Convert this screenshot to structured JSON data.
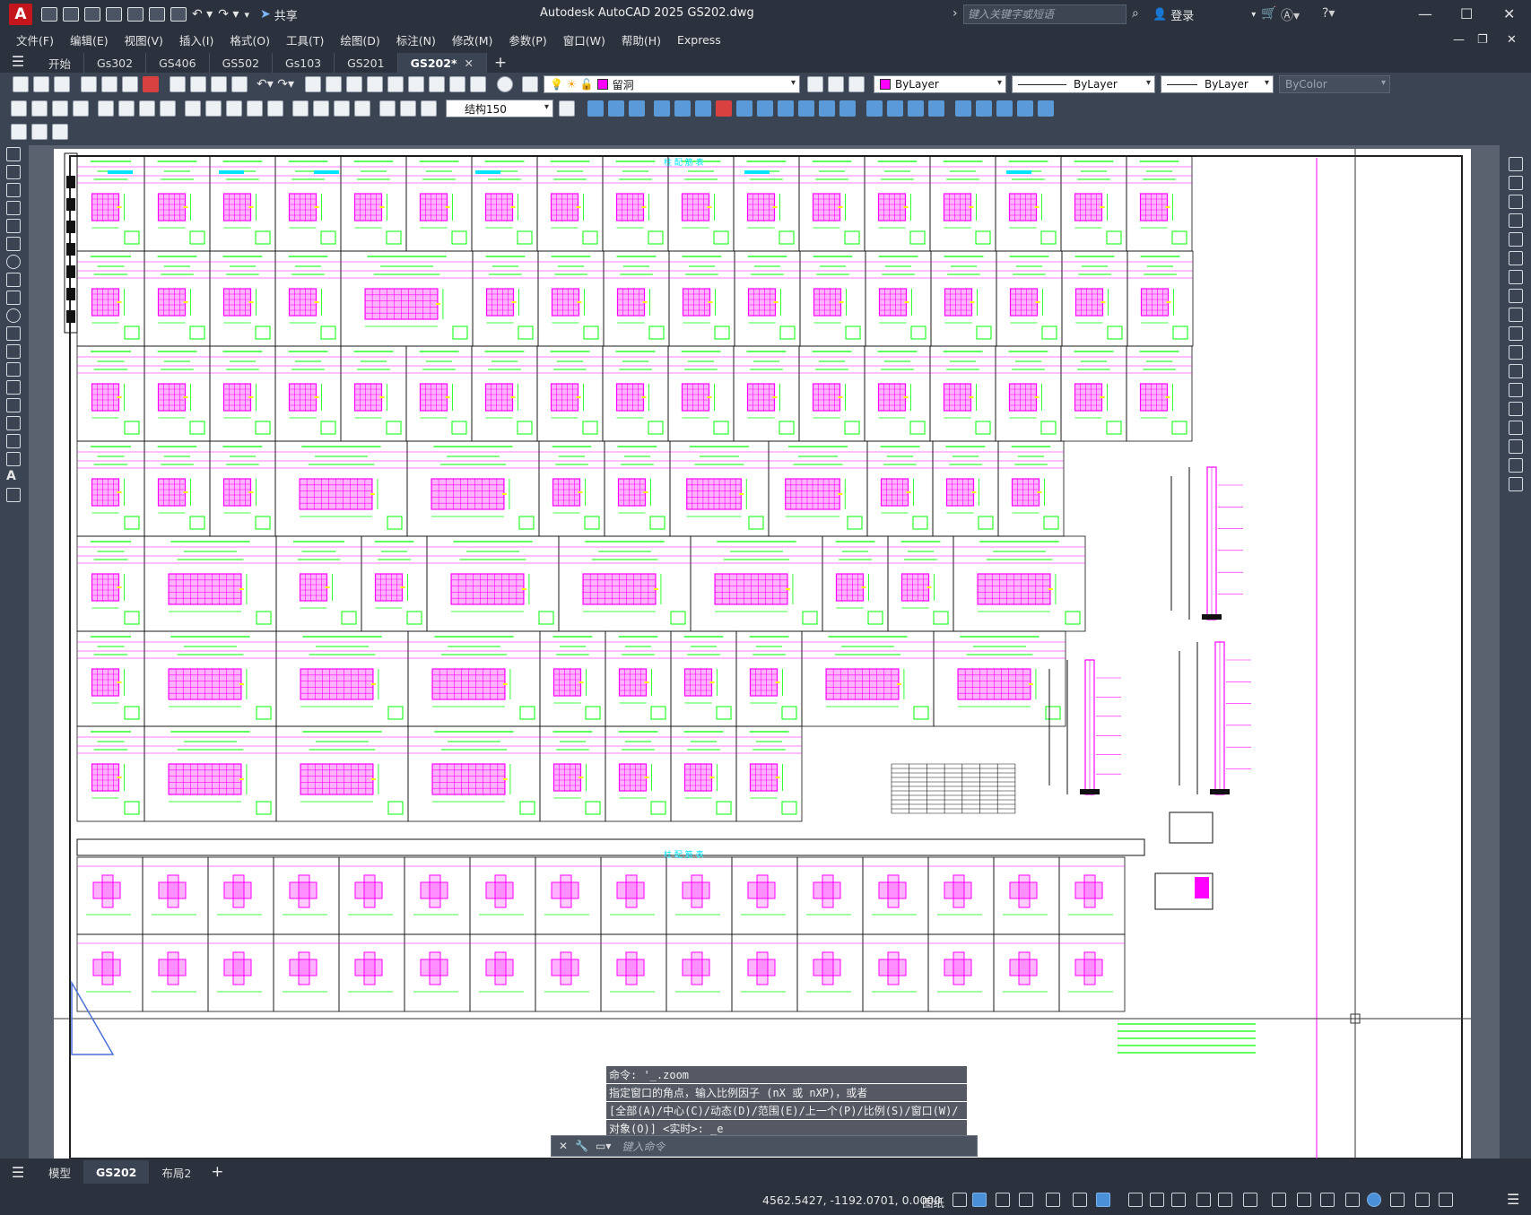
{
  "app": {
    "logo_letter": "A",
    "title": "Autodesk AutoCAD 2025    GS202.dwg",
    "share_label": "共享",
    "search_placeholder": "键入关键字或短语",
    "login_label": "登录"
  },
  "menu": [
    "文件(F)",
    "编辑(E)",
    "视图(V)",
    "插入(I)",
    "格式(O)",
    "工具(T)",
    "绘图(D)",
    "标注(N)",
    "修改(M)",
    "参数(P)",
    "窗口(W)",
    "帮助(H)",
    "Express"
  ],
  "doc_tabs": [
    {
      "label": "开始",
      "active": false
    },
    {
      "label": "Gs302",
      "active": false
    },
    {
      "label": "GS406",
      "active": false
    },
    {
      "label": "GS502",
      "active": false
    },
    {
      "label": "Gs103",
      "active": false
    },
    {
      "label": "GS201",
      "active": false
    },
    {
      "label": "GS202*",
      "active": true
    }
  ],
  "toolbar": {
    "layer_name": "留洞",
    "color": "ByLayer",
    "linetype": "ByLayer",
    "lineweight": "ByLayer",
    "plotstyle": "ByColor",
    "dimstyle": "结构150"
  },
  "drawing": {
    "table_title_top": "柱 配 筋 表",
    "table_title_bottom": "柱 配 筋 表"
  },
  "command": {
    "history": [
      "命令: '_.zoom",
      "指定窗口的角点，输入比例因子 (nX 或 nXP)，或者",
      "[全部(A)/中心(C)/动态(D)/范围(E)/上一个(P)/比例(S)/窗口(W)/",
      "对象(O)] <实时>: _e"
    ],
    "input_placeholder": "键入命令"
  },
  "layout_tabs": [
    {
      "label": "模型",
      "active": false
    },
    {
      "label": "GS202",
      "active": true
    },
    {
      "label": "布局2",
      "active": false
    }
  ],
  "status": {
    "coordinates": "4562.5427, -1192.0701, 0.0000",
    "space": "图纸"
  },
  "colors": {
    "magenta": "#ff00ff",
    "green": "#00ff00",
    "cyan": "#00e5ff",
    "accent": "#4a90d9"
  }
}
